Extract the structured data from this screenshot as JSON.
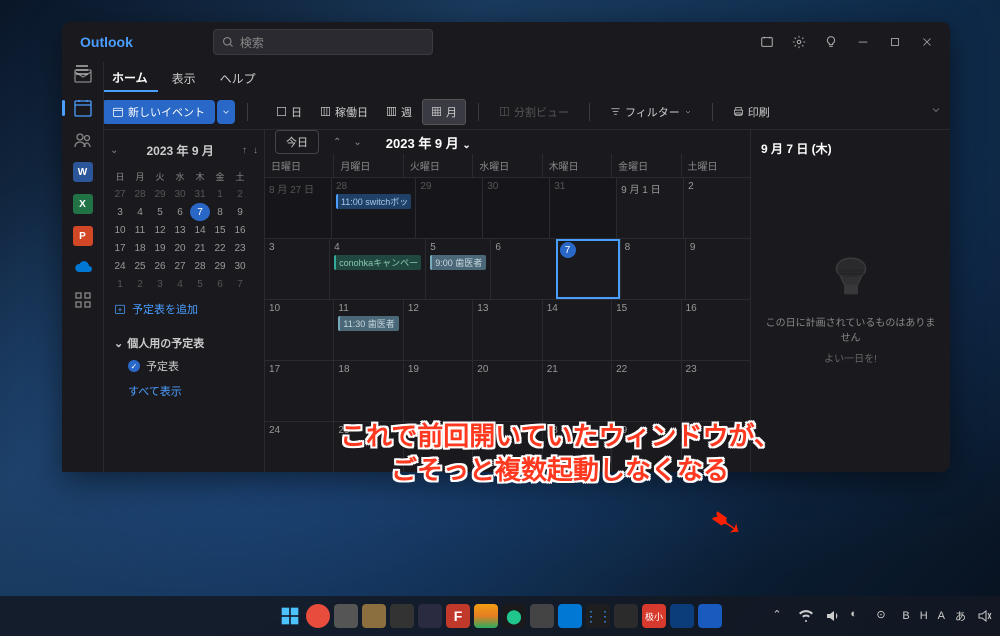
{
  "app": {
    "title": "Outlook"
  },
  "search": {
    "placeholder": "検索"
  },
  "menu": {
    "home": "ホーム",
    "view": "表示",
    "help": "ヘルプ"
  },
  "toolbar": {
    "new_event": "新しいイベント",
    "day": "日",
    "workday": "稼働日",
    "week": "週",
    "month": "月",
    "split_view": "分割ビュー",
    "filter": "フィルター",
    "print": "印刷"
  },
  "sidebar": {
    "month_label": "2023 年 9 月",
    "weekdays": [
      "日",
      "月",
      "火",
      "水",
      "木",
      "金",
      "土"
    ],
    "mini_cal": [
      [
        "27",
        "28",
        "29",
        "30",
        "31",
        "1",
        "2"
      ],
      [
        "3",
        "4",
        "5",
        "6",
        "7",
        "8",
        "9"
      ],
      [
        "10",
        "11",
        "12",
        "13",
        "14",
        "15",
        "16"
      ],
      [
        "17",
        "18",
        "19",
        "20",
        "21",
        "22",
        "23"
      ],
      [
        "24",
        "25",
        "26",
        "27",
        "28",
        "29",
        "30"
      ],
      [
        "1",
        "2",
        "3",
        "4",
        "5",
        "6",
        "7"
      ]
    ],
    "today_cell": "7",
    "dim_rows": [
      0,
      5
    ],
    "add_calendar": "予定表を追加",
    "personal_section": "個人用の予定表",
    "calendar_item": "予定表",
    "show_all": "すべて表示"
  },
  "main": {
    "today_btn": "今日",
    "title": "2023 年 9 月",
    "weekdays": [
      "日曜日",
      "月曜日",
      "火曜日",
      "水曜日",
      "木曜日",
      "金曜日",
      "土曜日"
    ],
    "weeks": [
      [
        {
          "d": "8 月 27 日",
          "dim": true
        },
        {
          "d": "28",
          "dim": true,
          "ev": [
            {
              "t": "11:00 switchボッ",
              "c": "e1"
            }
          ]
        },
        {
          "d": "29",
          "dim": true
        },
        {
          "d": "30",
          "dim": true
        },
        {
          "d": "31",
          "dim": true
        },
        {
          "d": "9 月 1 日"
        },
        {
          "d": "2"
        }
      ],
      [
        {
          "d": "3"
        },
        {
          "d": "4",
          "ev": [
            {
              "t": "conohkaキャンペー",
              "c": "e2"
            }
          ]
        },
        {
          "d": "5",
          "ev": [
            {
              "t": "9:00 歯医者",
              "c": "e3"
            }
          ]
        },
        {
          "d": "6"
        },
        {
          "d": "7",
          "today": true,
          "selected": true
        },
        {
          "d": "8"
        },
        {
          "d": "9"
        }
      ],
      [
        {
          "d": "10"
        },
        {
          "d": "11",
          "ev": [
            {
              "t": "11:30 歯医者",
              "c": "e3"
            }
          ]
        },
        {
          "d": "12"
        },
        {
          "d": "13"
        },
        {
          "d": "14"
        },
        {
          "d": "15"
        },
        {
          "d": "16"
        }
      ],
      [
        {
          "d": "17"
        },
        {
          "d": "18"
        },
        {
          "d": "19"
        },
        {
          "d": "20"
        },
        {
          "d": "21"
        },
        {
          "d": "22"
        },
        {
          "d": "23"
        }
      ],
      [
        {
          "d": "24"
        },
        {
          "d": "25"
        },
        {
          "d": "26"
        },
        {
          "d": "27"
        },
        {
          "d": "28"
        },
        {
          "d": "29"
        },
        {
          "d": "30"
        }
      ]
    ]
  },
  "detail": {
    "date": "9 月 7 日 (木)",
    "empty_msg": "この日に計画されているものはありません",
    "empty_sub": "よい一日を!"
  },
  "annotation": {
    "line1": "これで前回開いていたウィンドウが、",
    "line2": "ごそっと複数起動しなくなる"
  },
  "tray": {
    "lang1": "B",
    "lang2": "H",
    "lang3": "A",
    "ime": "あ"
  }
}
